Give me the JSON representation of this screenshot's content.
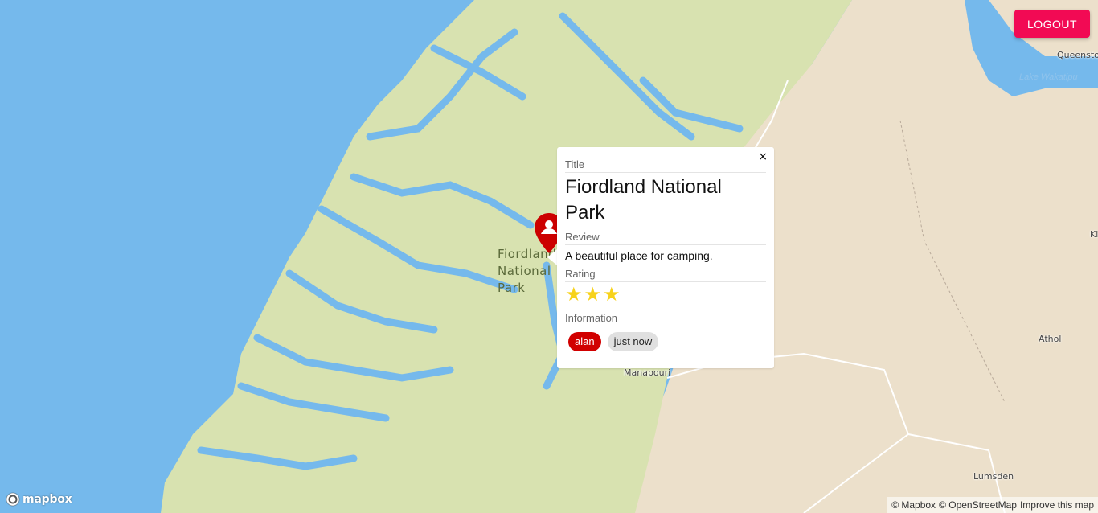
{
  "header": {
    "logout_label": "LOGOUT"
  },
  "map": {
    "park_label": "Fiordland National Park",
    "places": {
      "queenstown": "Queenstown",
      "lake_wakatipu": "Lake Wakatipu",
      "manapouri": "Manapouri",
      "athol": "Athol",
      "lumsden": "Lumsden",
      "kingston_partial": "Ki"
    },
    "colors": {
      "water": "#75b9ec",
      "park": "#d8e2b0",
      "land": "#ece0cb",
      "marker": "#cc0000"
    }
  },
  "popup": {
    "close_label": "×",
    "title_label": "Title",
    "title": "Fiordland National Park",
    "review_label": "Review",
    "review": "A beautiful place for camping.",
    "rating_label": "Rating",
    "rating": 3,
    "star_glyph": "★",
    "info_label": "Information",
    "user": "alan",
    "time": "just now"
  },
  "branding": {
    "logo_text": "mapbox"
  },
  "attribution": {
    "mapbox": "© Mapbox",
    "osm": "© OpenStreetMap",
    "improve": "Improve this map"
  }
}
